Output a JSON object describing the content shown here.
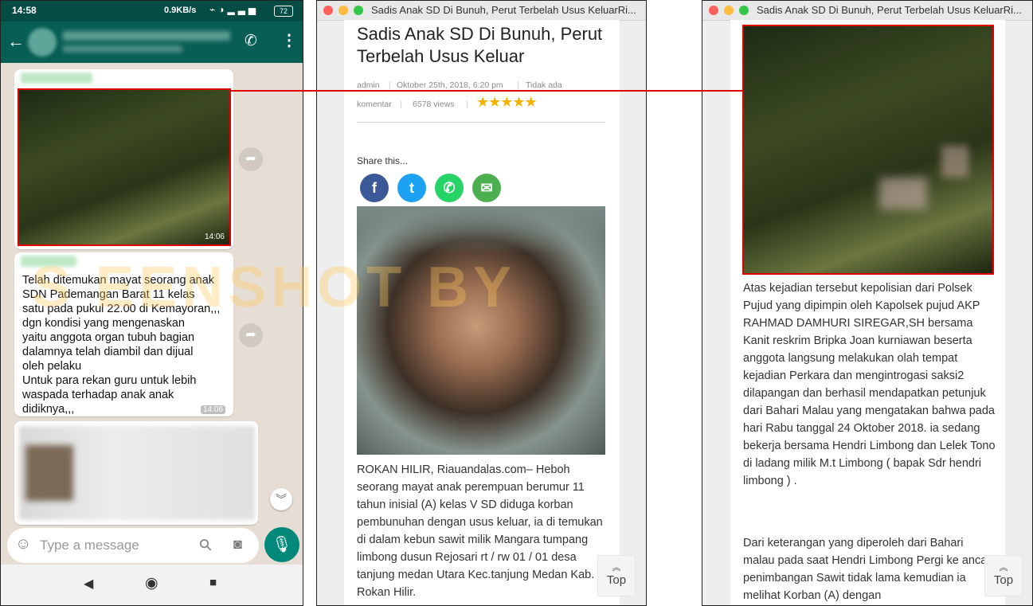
{
  "phone": {
    "status_time": "14:58",
    "status_speed": "0.9KB/s",
    "battery": "72",
    "message_time_1": "14:06",
    "message_text": "Telah ditemukan mayat seorang anak\nSDN Pademangan Barat 11 kelas\nsatu pada pukul 22.00 di Kemayoran,,,\ndgn kondisi yang mengenaskan\nyaitu anggota organ tubuh bagian\ndalamnya telah diambil dan dijual\noleh pelaku\nUntuk para rekan guru untuk lebih\nwaspada terhadap anak anak\ndidiknya,,,",
    "message_time_2": "14:06",
    "input_placeholder": "Type a message",
    "icons": {
      "back": "back-arrow-icon",
      "call": "add-call-icon",
      "menu": "more-vert-icon",
      "forward": "forward-icon",
      "emoji": "emoji-icon",
      "attach": "paperclip-icon",
      "camera": "camera-icon",
      "mic": "mic-icon",
      "scroll_down": "double-chevron-down-icon"
    }
  },
  "browser1": {
    "window_title": "Sadis Anak SD Di Bunuh, Perut Terbelah Usus KeluarRi...",
    "article_title": "Sadis Anak SD Di Bunuh, Perut Terbelah Usus Keluar",
    "meta_author": "admin",
    "meta_date": "Oktober 25th, 2018, 6:20 pm",
    "meta_comment_part1": "Tidak ada",
    "meta_comment_part2": "komentar",
    "meta_views": "6578 views",
    "rating_stars": "★★★★★",
    "rating_value": 4.5,
    "share_label": "Share this...",
    "body": "ROKAN HILIR, Riauandalas.com– Heboh seorang mayat anak perempuan berumur 11  tahun  inisial (A) kelas V SD  diduga korban pembunuhan dengan usus keluar, ia di temukan di dalam kebun sawit milik Mangara tumpang limbong dusun Rejosari rt / rw 01 / 01 desa tanjung medan Utara Kec.tanjung Medan Kab. Rokan Hilir.",
    "top_label": "Top"
  },
  "browser2": {
    "window_title": "Sadis Anak SD Di Bunuh, Perut Terbelah Usus KeluarRi...",
    "para1": "Atas kejadian tersebut kepolisian dari Polsek Pujud yang dipimpin oleh Kapolsek pujud AKP RAHMAD DAMHURI SIREGAR,SH bersama Kanit reskrim Bripka Joan kurniawan beserta anggota langsung melakukan olah tempat kejadian Perkara dan mengintrogasi saksi2 dilapangan dan berhasil mendapatkan petunjuk dari Bahari Malau yang mengatakan bahwa pada hari Rabu tanggal 24 Oktober 2018. ia sedang bekerja bersama Hendri Limbong dan Lelek Tono di ladang milik M.t Limbong ( bapak Sdr hendri limbong ) .",
    "para2": "Dari keterangan yang diperoleh dari Bahari malau pada saat Hendri Limbong Pergi ke ancak penimbangan Sawit tidak lama kemudian ia melihat Korban (A) dengan",
    "top_label": "Top"
  },
  "colors": {
    "whatsapp_dark": "#075e54",
    "whatsapp_status": "#054d44",
    "mic_green": "#00897b",
    "highlight_red": "#e00000",
    "facebook": "#3b5998",
    "twitter": "#1da1f2",
    "whatsapp_share": "#25d366",
    "email": "#4caf50"
  }
}
